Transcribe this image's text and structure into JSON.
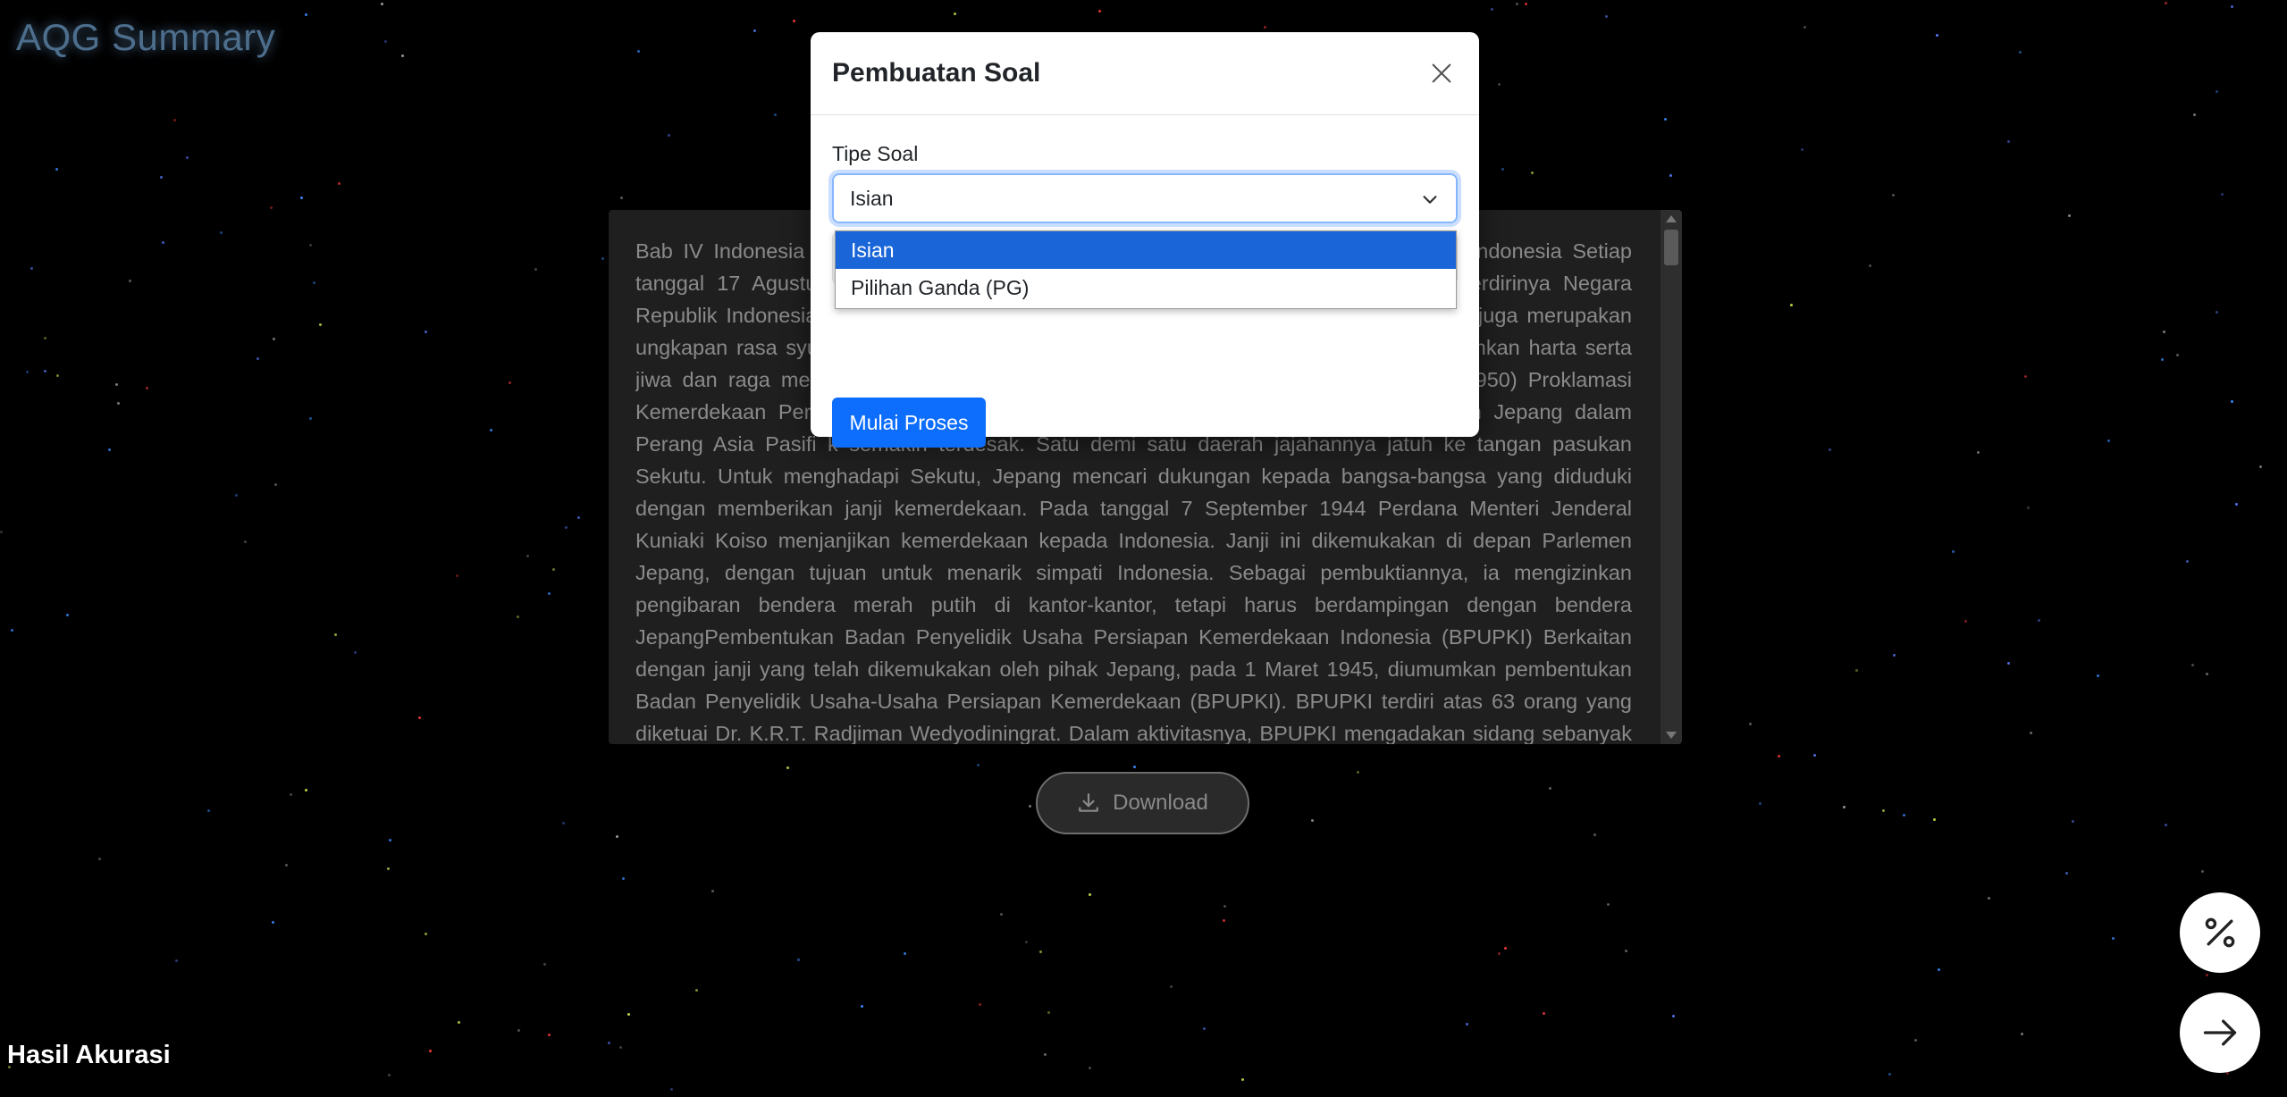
{
  "app_title": "AQG Summary",
  "summary_text": "Bab IV Indonesia dan Perjuangan Kemerdekaan Peristiwa Proklamasi Kemerdekaan Indonesia Setiap tanggal 17 Agustus, kita memperingati peristiwa penting, yaitu hari lahirnya atau berdirinya Negara Republik Indonesia yang kita cintai ini melalui proklamasi kemerdekaan. Peringatan ini juga merupakan ungkapan rasa syukur dan penghormatan kepada para pahlawan yang telah mengorbankan harta serta jiwa dan raga mereka untuk meraih kemerdekaan Indonesia. (Sumber: Kemdikbud, 1950) Proklamasi Kemerdekaan Persiapan Kemerdekaan Indonesia Pada akhir tahun 1944, kedudukan Jepang dalam Perang Asia Pasifi k semakin terdesak. Satu demi satu daerah jajahannya jatuh ke tangan pasukan Sekutu. Untuk menghadapi Sekutu, Jepang mencari dukungan kepada bangsa-bangsa yang diduduki dengan memberikan janji kemerdekaan. Pada tanggal 7 September 1944 Perdana Menteri Jenderal Kuniaki Koiso menjanjikan kemerdekaan kepada Indonesia. Janji ini dikemukakan di depan Parlemen Jepang, dengan tujuan untuk menarik simpati Indonesia. Sebagai pembuktiannya, ia mengizinkan pengibaran bendera merah putih di kantor-kantor, tetapi harus berdampingan dengan bendera JepangPembentukan Badan Penyelidik Usaha Persiapan Kemerdekaan Indonesia (BPUPKI) Berkaitan dengan janji yang telah dikemukakan oleh pihak Jepang, pada 1 Maret 1945, diumumkan pembentukan Badan Penyelidik Usaha-Usaha Persiapan Kemerdekaan (BPUPKI). BPUPKI terdiri atas 63 orang yang diketuai Dr. K.R.T. Radjiman Wedyodiningrat. Dalam aktivitasnya, BPUPKI mengadakan sidang sebanyak dua kali. Sidang pertama",
  "download_label": "Download",
  "footer_label": "Hasil Akurasi",
  "modal": {
    "title": "Pembuatan Soal",
    "field_label": "Tipe Soal",
    "selected_value": "Isian",
    "options": [
      "Isian",
      "Pilihan Ganda (PG)"
    ],
    "submit_label": "Mulai Proses"
  },
  "icons": {
    "close": "close-icon",
    "chevron": "chevron-down-icon",
    "download": "download-icon",
    "percent": "percent-icon",
    "next": "arrow-right-icon"
  },
  "colors": {
    "primary": "#0d6efd",
    "option_highlight": "#1a66d8",
    "title_glow": "#4d6e8c"
  }
}
